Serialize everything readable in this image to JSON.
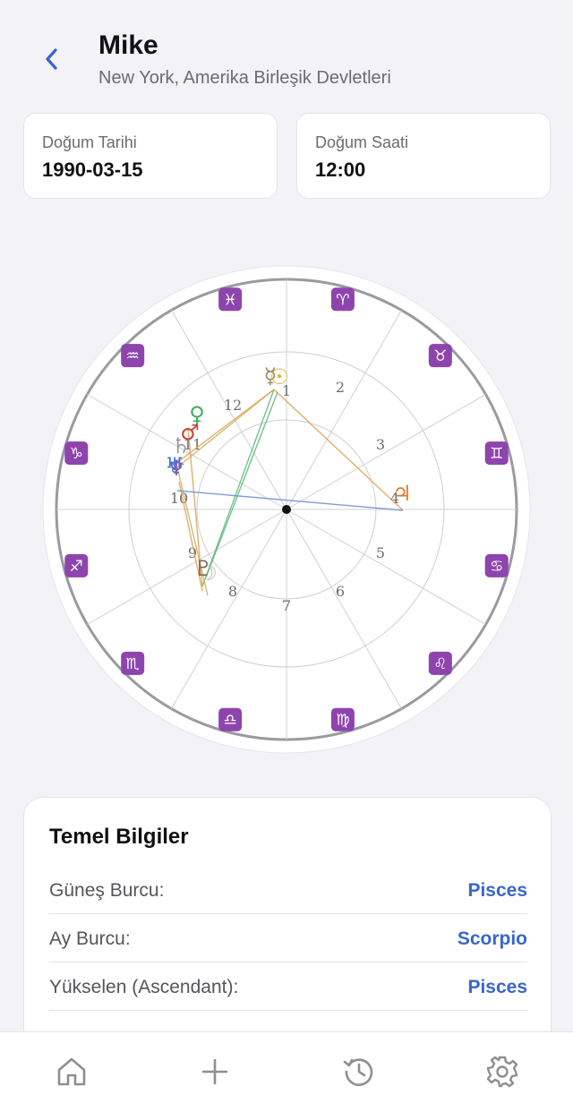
{
  "header": {
    "name": "Mike",
    "location": "New York, Amerika Birleşik Devletleri"
  },
  "birth_date": {
    "label": "Doğum Tarihi",
    "value": "1990-03-15"
  },
  "birth_time": {
    "label": "Doğum Saati",
    "value": "12:00"
  },
  "chart": {
    "zodiac": [
      {
        "sign": "aries",
        "glyph": "♈"
      },
      {
        "sign": "taurus",
        "glyph": "♉"
      },
      {
        "sign": "gemini",
        "glyph": "♊"
      },
      {
        "sign": "cancer",
        "glyph": "♋"
      },
      {
        "sign": "leo",
        "glyph": "♌"
      },
      {
        "sign": "virgo",
        "glyph": "♍"
      },
      {
        "sign": "libra",
        "glyph": "♎"
      },
      {
        "sign": "scorpio",
        "glyph": "♏"
      },
      {
        "sign": "sagittarius",
        "glyph": "♐"
      },
      {
        "sign": "capricorn",
        "glyph": "♑"
      },
      {
        "sign": "aquarius",
        "glyph": "♒"
      },
      {
        "sign": "pisces",
        "glyph": "♓"
      }
    ],
    "houses": [
      "1",
      "2",
      "3",
      "4",
      "5",
      "6",
      "7",
      "8",
      "9",
      "10",
      "11",
      "12"
    ],
    "planets": [
      {
        "name": "mercury",
        "glyph": "☿",
        "color": "#9c8e6a"
      },
      {
        "name": "sun",
        "glyph": "☉",
        "color": "#e0b23a"
      },
      {
        "name": "jupiter",
        "glyph": "♃",
        "color": "#e07b2a"
      },
      {
        "name": "venus",
        "glyph": "♀",
        "color": "#3fae5c"
      },
      {
        "name": "mars",
        "glyph": "♂",
        "color": "#c8463c"
      },
      {
        "name": "saturn",
        "glyph": "♄",
        "color": "#9a9aa2"
      },
      {
        "name": "uranus",
        "glyph": "♅",
        "color": "#3a7bd5"
      },
      {
        "name": "neptune",
        "glyph": "♆",
        "color": "#7b5bb8"
      },
      {
        "name": "pluto",
        "glyph": "♇",
        "color": "#7a6a5a"
      },
      {
        "name": "moon",
        "glyph": "☽",
        "color": "#b8b8b0"
      }
    ],
    "colors": {
      "zodiac_badge": "#8e44ad",
      "outer_ring": "#9a9aa2",
      "aspect_orange": "#e0a050",
      "aspect_green": "#5cb87a",
      "aspect_blue": "#6a8fd0",
      "aspect_olive": "#c8b060"
    }
  },
  "basics": {
    "title": "Temel Bilgiler",
    "rows": [
      {
        "label": "Güneş Burcu:",
        "value": "Pisces"
      },
      {
        "label": "Ay Burcu:",
        "value": "Scorpio"
      },
      {
        "label": "Yükselen (Ascendant):",
        "value": "Pisces"
      }
    ]
  },
  "tabs": [
    {
      "name": "home",
      "icon": "home-icon"
    },
    {
      "name": "add",
      "icon": "plus-icon"
    },
    {
      "name": "history",
      "icon": "history-icon"
    },
    {
      "name": "settings",
      "icon": "gear-icon"
    }
  ],
  "accent_color": "#3a66c9"
}
